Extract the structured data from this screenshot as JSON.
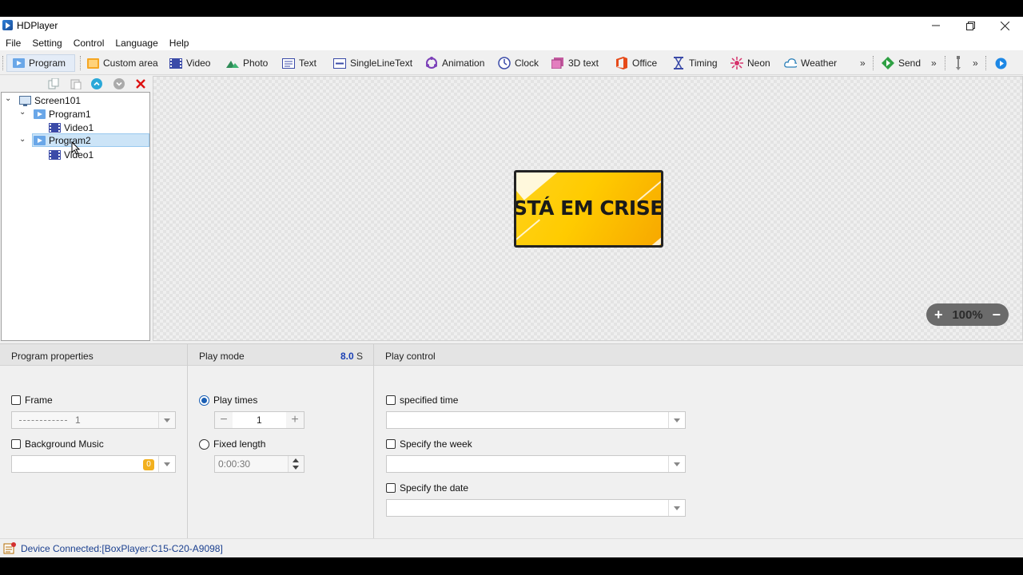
{
  "app": {
    "title": "HDPlayer"
  },
  "menu": [
    "File",
    "Setting",
    "Control",
    "Language",
    "Help"
  ],
  "toolbar": {
    "program": "Program",
    "custom_area": "Custom area",
    "video": "Video",
    "photo": "Photo",
    "text": "Text",
    "single_line_text": "SingleLineText",
    "animation": "Animation",
    "clock": "Clock",
    "text_3d": "3D text",
    "office": "Office",
    "timing": "Timing",
    "neon": "Neon",
    "weather": "Weather",
    "send": "Send",
    "more": "»"
  },
  "tree": {
    "screen": "Screen101",
    "program1": "Program1",
    "program1_video": "Video1",
    "program2": "Program2",
    "program2_video": "Video1"
  },
  "canvas": {
    "preview_text": "STÁ EM CRISE",
    "zoom": "100%",
    "zoom_in": "+",
    "zoom_out": "−"
  },
  "program_properties": {
    "header": "Program properties",
    "frame_label": "Frame",
    "frame_value": "1",
    "background_music_label": "Background Music",
    "music_badge": "0"
  },
  "play_mode": {
    "header": "Play mode",
    "duration": "8.0",
    "duration_unit": "S",
    "play_times_label": "Play times",
    "play_times_value": "1",
    "fixed_length_label": "Fixed length",
    "fixed_length_value": "0:00:30"
  },
  "play_control": {
    "header": "Play control",
    "specified_time_label": "specified time",
    "specify_week_label": "Specify the week",
    "specify_date_label": "Specify the date"
  },
  "status": {
    "text": "Device Connected:[BoxPlayer:C15-C20-A9098]"
  },
  "colors": {
    "accent": "#1a5fb4",
    "selection": "#cce4f7",
    "zoom_bg": "#6b6b6b",
    "status_text": "#1a3f8f"
  }
}
